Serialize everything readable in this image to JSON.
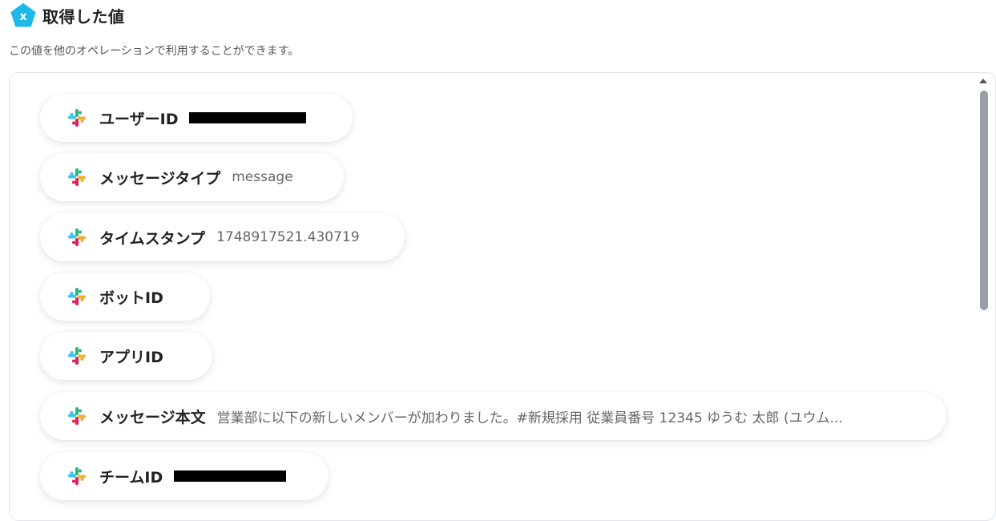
{
  "header": {
    "title": "取得した値",
    "icon": "variable-x-icon",
    "icon_color": "#1fb8e8"
  },
  "subtitle": "この値を他のオペレーションで利用することができます。",
  "items": [
    {
      "label": "ユーザーID",
      "value": "",
      "redacted": true,
      "icon": "slack-icon"
    },
    {
      "label": "メッセージタイプ",
      "value": "message",
      "icon": "slack-icon"
    },
    {
      "label": "タイムスタンプ",
      "value": "1748917521.430719",
      "icon": "slack-icon"
    },
    {
      "label": "ボットID",
      "value": "",
      "icon": "slack-icon"
    },
    {
      "label": "アプリID",
      "value": "",
      "icon": "slack-icon"
    },
    {
      "label": "メッセージ本文",
      "value": "営業部に以下の新しいメンバーが加わりました。#新規採用 従業員番号 12345 ゆうむ 太郎 (ユウム...",
      "icon": "slack-icon"
    },
    {
      "label": "チームID",
      "value": "",
      "redacted": true,
      "icon": "slack-icon"
    }
  ],
  "colors": {
    "slack_blue": "#36C5F0",
    "slack_green": "#2EB67D",
    "slack_yellow": "#ECB22E",
    "slack_red": "#E01E5A"
  }
}
